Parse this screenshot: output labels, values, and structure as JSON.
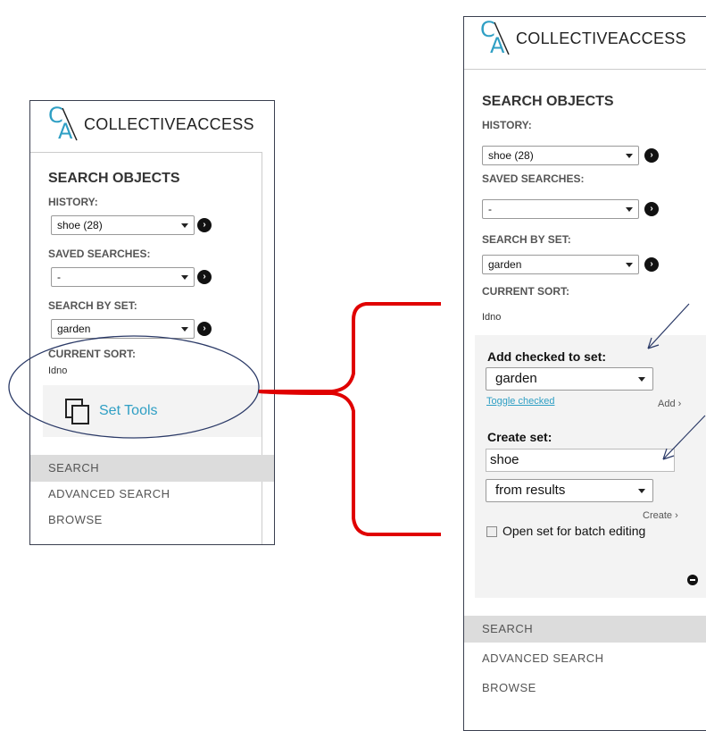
{
  "logo": {
    "mark_top": "C",
    "mark_bottom": "A",
    "wordmark": "COLLECTIVEACCESS"
  },
  "left_panel": {
    "heading": "SEARCH OBJECTS",
    "history_label": "HISTORY:",
    "history_value": "shoe (28)",
    "saved_label": "SAVED SEARCHES:",
    "saved_value": "-",
    "set_label": "SEARCH BY SET:",
    "set_value": "garden",
    "sort_label": "CURRENT SORT:",
    "sort_value": "Idno",
    "set_tools": "Set Tools",
    "nav": [
      "SEARCH",
      "ADVANCED SEARCH",
      "BROWSE"
    ]
  },
  "right_panel": {
    "heading": "SEARCH OBJECTS",
    "history_label": "HISTORY:",
    "history_value": "shoe (28)",
    "saved_label": "SAVED SEARCHES:",
    "saved_value": "-",
    "set_label": "SEARCH BY SET:",
    "set_value": "garden",
    "sort_label": "CURRENT SORT:",
    "sort_value": "Idno",
    "add_checked_label": "Add checked to set:",
    "add_set_value": "garden",
    "toggle_checked": "Toggle checked",
    "add_link": "Add",
    "create_set_label": "Create set:",
    "create_set_name": "shoe",
    "create_from_value": "from results",
    "create_link": "Create",
    "open_batch": "Open set for batch editing",
    "nav": [
      "SEARCH",
      "ADVANCED SEARCH",
      "BROWSE"
    ]
  },
  "colors": {
    "brand": "#2f9fc4",
    "annotation_bracket": "#e00000",
    "annotation_ellipse": "#2b3a67"
  }
}
